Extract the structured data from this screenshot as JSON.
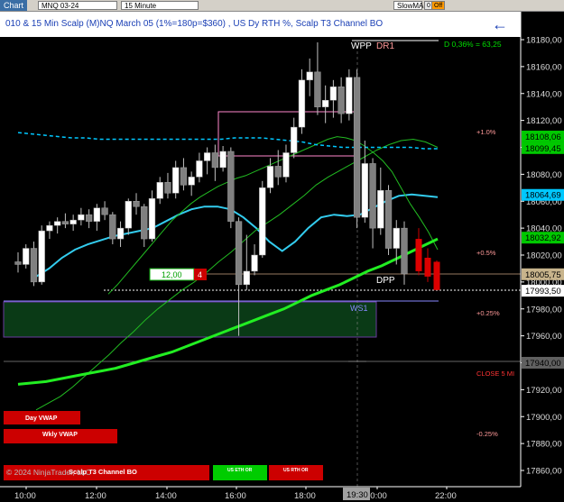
{
  "toolbar": {
    "chart_label": "Chart",
    "instrument": "MNQ 03-24",
    "timeframe": "15 Minute",
    "indicator": "SlowMA",
    "btn1": "0",
    "btn2": "Off"
  },
  "title": "010 & 15 Min Scalp (M)NQ March 05 (1%=180p=$360) , US Dy RTH %, Scalp T3 Channel BO",
  "footer_copyright": "© 2024 NinjaTrader, LLC",
  "axis": {
    "y_ticks": [
      "18180,00",
      "18160,00",
      "18140,00",
      "18120,00",
      "18100,00",
      "18080,00",
      "18060,00",
      "18040,00",
      "18020,00",
      "18000,00",
      "17980,00",
      "17960,00",
      "17940,00",
      "17920,00",
      "17900,00",
      "17880,00",
      "17860,00"
    ],
    "x_ticks": [
      "10:00",
      "12:00",
      "14:00",
      "16:00",
      "18:00",
      "20:00",
      "22:00"
    ],
    "crosshair_time": "19:30"
  },
  "price_markers": [
    {
      "label": "18108,06",
      "color": "#00c800",
      "text": "#000"
    },
    {
      "label": "18099,45",
      "color": "#00c800",
      "text": "#000"
    },
    {
      "label": "18064,69",
      "color": "#00c8ff",
      "text": "#000"
    },
    {
      "label": "18032,92",
      "color": "#00c800",
      "text": "#000"
    },
    {
      "label": "18005,75",
      "color": "#c8b48c",
      "text": "#000"
    },
    {
      "label": "17993,50",
      "color": "#ffffff",
      "text": "#000"
    },
    {
      "label": "17940,00",
      "color": "#606060",
      "text": "#000"
    }
  ],
  "annotations": {
    "wpp": "WPP",
    "dr1": "DR1",
    "dpp": "DPP",
    "ws1": "WS1",
    "daily_stat": "D 0,36% = 63,25",
    "pct_plus1": "+1.0%",
    "pct_plus05": "+0.5%",
    "pct_plus025": "+0.25%",
    "pct_minus025": "-0.25%",
    "close_label": "CLOSE 5 MI",
    "order_qty": "12,00",
    "order_num": "4"
  },
  "buttons": {
    "day_vwap": "Day VWAP",
    "wkly_vwap": "Wkly VWAP",
    "scalp_t3": "Scalp T3 Channel BO",
    "us_eth_or": "US ETH OR",
    "us_rth_or": "US RTH OR"
  },
  "colors": {
    "bull": "#ffffff",
    "bear": "#808080",
    "cyan_dash": "#00c8ff",
    "ema_cyan": "#33ccee",
    "slow_green": "#22dd22",
    "pink_box": "#ff88cc",
    "ws1_zone": "#0a3a16",
    "red": "#cc0000"
  },
  "chart_data": {
    "type": "candlestick",
    "x_range": [
      "09:30",
      "22:30"
    ],
    "ylim": [
      17850,
      18188
    ],
    "candles": [
      {
        "o": 18015,
        "h": 18022,
        "l": 18007,
        "c": 18013
      },
      {
        "o": 18013,
        "h": 18028,
        "l": 18010,
        "c": 18025
      },
      {
        "o": 18025,
        "h": 18030,
        "l": 17997,
        "c": 18000
      },
      {
        "o": 18000,
        "h": 18042,
        "l": 17998,
        "c": 18038
      },
      {
        "o": 18038,
        "h": 18045,
        "l": 18032,
        "c": 18042
      },
      {
        "o": 18042,
        "h": 18048,
        "l": 18036,
        "c": 18045
      },
      {
        "o": 18045,
        "h": 18051,
        "l": 18040,
        "c": 18043
      },
      {
        "o": 18043,
        "h": 18050,
        "l": 18038,
        "c": 18046
      },
      {
        "o": 18046,
        "h": 18055,
        "l": 18042,
        "c": 18050
      },
      {
        "o": 18050,
        "h": 18054,
        "l": 18040,
        "c": 18045
      },
      {
        "o": 18045,
        "h": 18058,
        "l": 18038,
        "c": 18055
      },
      {
        "o": 18055,
        "h": 18060,
        "l": 18046,
        "c": 18050
      },
      {
        "o": 18050,
        "h": 18052,
        "l": 18028,
        "c": 18032
      },
      {
        "o": 18032,
        "h": 18045,
        "l": 18026,
        "c": 18040
      },
      {
        "o": 18040,
        "h": 18062,
        "l": 18035,
        "c": 18060
      },
      {
        "o": 18060,
        "h": 18066,
        "l": 18050,
        "c": 18056
      },
      {
        "o": 18056,
        "h": 18058,
        "l": 18026,
        "c": 18032
      },
      {
        "o": 18032,
        "h": 18068,
        "l": 18030,
        "c": 18062
      },
      {
        "o": 18062,
        "h": 18078,
        "l": 18058,
        "c": 18074
      },
      {
        "o": 18074,
        "h": 18081,
        "l": 18062,
        "c": 18066
      },
      {
        "o": 18066,
        "h": 18090,
        "l": 18062,
        "c": 18085
      },
      {
        "o": 18085,
        "h": 18092,
        "l": 18068,
        "c": 18072
      },
      {
        "o": 18072,
        "h": 18082,
        "l": 18064,
        "c": 18078
      },
      {
        "o": 18078,
        "h": 18096,
        "l": 18074,
        "c": 18090
      },
      {
        "o": 18090,
        "h": 18100,
        "l": 18080,
        "c": 18096
      },
      {
        "o": 18096,
        "h": 18102,
        "l": 18075,
        "c": 18085
      },
      {
        "o": 18085,
        "h": 18101,
        "l": 18082,
        "c": 18097
      },
      {
        "o": 18097,
        "h": 18100,
        "l": 18040,
        "c": 18045
      },
      {
        "o": 18045,
        "h": 18048,
        "l": 17960,
        "c": 17998
      },
      {
        "o": 17998,
        "h": 18035,
        "l": 17994,
        "c": 18008
      },
      {
        "o": 18008,
        "h": 18028,
        "l": 18005,
        "c": 18020
      },
      {
        "o": 18020,
        "h": 18075,
        "l": 18018,
        "c": 18070
      },
      {
        "o": 18070,
        "h": 18092,
        "l": 18066,
        "c": 18086
      },
      {
        "o": 18086,
        "h": 18098,
        "l": 18072,
        "c": 18078
      },
      {
        "o": 18078,
        "h": 18102,
        "l": 18074,
        "c": 18096
      },
      {
        "o": 18096,
        "h": 18122,
        "l": 18092,
        "c": 18115
      },
      {
        "o": 18115,
        "h": 18158,
        "l": 18110,
        "c": 18150
      },
      {
        "o": 18150,
        "h": 18166,
        "l": 18138,
        "c": 18156
      },
      {
        "o": 18156,
        "h": 18178,
        "l": 18124,
        "c": 18130
      },
      {
        "o": 18130,
        "h": 18146,
        "l": 18118,
        "c": 18135
      },
      {
        "o": 18135,
        "h": 18150,
        "l": 18122,
        "c": 18145
      },
      {
        "o": 18145,
        "h": 18152,
        "l": 18118,
        "c": 18125
      },
      {
        "o": 18125,
        "h": 18158,
        "l": 18120,
        "c": 18152
      },
      {
        "o": 18152,
        "h": 18158,
        "l": 18040,
        "c": 18048
      },
      {
        "o": 18048,
        "h": 18105,
        "l": 18044,
        "c": 18088
      },
      {
        "o": 18088,
        "h": 18092,
        "l": 18025,
        "c": 18040
      },
      {
        "o": 18040,
        "h": 18085,
        "l": 18035,
        "c": 18068
      },
      {
        "o": 18068,
        "h": 18072,
        "l": 18020,
        "c": 18025
      },
      {
        "o": 18025,
        "h": 18046,
        "l": 18013,
        "c": 18040
      },
      {
        "o": 18040,
        "h": 18045,
        "l": 17998,
        "c": 18006
      }
    ],
    "series": [
      {
        "values": [
          18004,
          18010,
          18018,
          18024,
          18028,
          18031,
          18034,
          18036,
          18038,
          18040,
          18045,
          18050,
          18054,
          18056,
          18056,
          18054,
          18048,
          18040,
          18030,
          18023,
          18030,
          18040,
          18048,
          18050,
          18049,
          18050,
          18055,
          18060,
          18064,
          18065,
          18064,
          18063
        ]
      },
      {
        "values": [
          17905,
          17910,
          17915,
          17922,
          17930,
          17938,
          17946,
          17955,
          17963,
          17972,
          17980,
          17987,
          17994,
          18000,
          18007,
          18015,
          18022,
          18030,
          18038,
          18044,
          18050,
          18057,
          18064,
          18072,
          18078,
          18083,
          18088,
          18093,
          18098,
          18102,
          18105,
          18106,
          18104,
          18100
        ]
      },
      {
        "values": [
          17991,
          17998,
          18006,
          18014,
          18022,
          18030,
          18038,
          18046,
          18052,
          18058,
          18063,
          18067,
          18071,
          18074,
          18077,
          18079,
          18082,
          18085,
          18088,
          18091,
          18094,
          18097,
          18100,
          18103,
          18106,
          18108,
          18107,
          18105,
          18101,
          18096,
          18090,
          18082,
          18070,
          18058,
          18048,
          18037,
          18024
        ]
      },
      {
        "values": [
          17924,
          17925,
          17926,
          17928,
          17930,
          17932,
          17934,
          17936,
          17939,
          17942,
          17945,
          17948,
          17952,
          17956,
          17960,
          17964,
          17968,
          17972,
          17976,
          17980,
          17985,
          17990,
          17994,
          17998,
          18003,
          18008,
          18012,
          18017,
          18022,
          18027,
          18032
        ]
      },
      {
        "values": [
          18111,
          18110,
          18109,
          18108,
          18107,
          18107,
          18106,
          18106,
          18106,
          18106,
          18106,
          18106,
          18106,
          18106,
          18106,
          18106,
          18107,
          18107,
          18107,
          18106,
          18105,
          18104,
          18102,
          18101,
          18100,
          18100,
          18100,
          18100,
          18100,
          18100,
          18099,
          18099
        ]
      }
    ],
    "red_candles": [
      {
        "o": 18032,
        "h": 18040,
        "l": 18005,
        "c": 18008
      },
      {
        "o": 18018,
        "h": 18025,
        "l": 18000,
        "c": 18004
      },
      {
        "o": 18015,
        "h": 18016,
        "l": 17994,
        "c": 17994
      }
    ]
  }
}
